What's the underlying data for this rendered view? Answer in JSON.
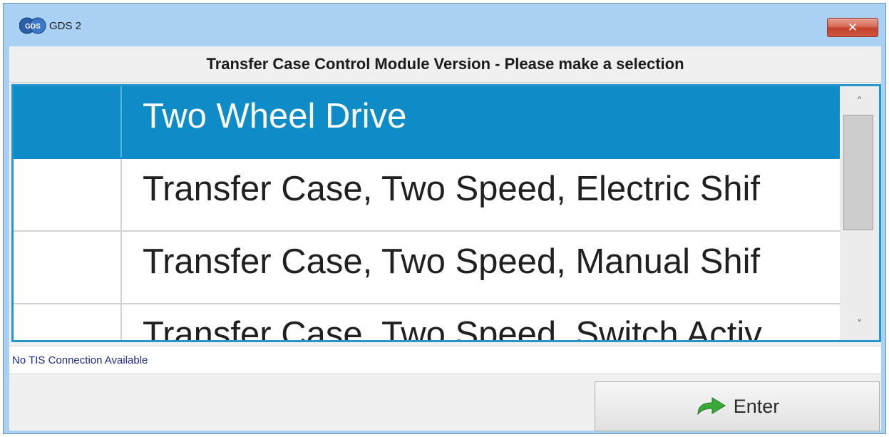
{
  "window": {
    "title": "GDS 2",
    "app_icon_text": "GDS",
    "close_symbol": "✕"
  },
  "header": {
    "title": "Transfer Case Control Module Version - Please make a selection"
  },
  "list": {
    "items": [
      {
        "label": "Two Wheel Drive",
        "selected": true
      },
      {
        "label": "Transfer Case, Two Speed, Electric Shif",
        "selected": false
      },
      {
        "label": "Transfer Case, Two Speed, Manual Shif",
        "selected": false
      },
      {
        "label": "Transfer Case, Two Speed, Switch Activ",
        "selected": false
      }
    ],
    "scroll_up_symbol": "˄",
    "scroll_down_symbol": "˅"
  },
  "status": {
    "text": "No TIS Connection Available"
  },
  "footer": {
    "enter_label": "Enter",
    "enter_icon": "green-arrow-icon"
  },
  "colors": {
    "selection": "#0e8cc8",
    "window_frame": "#a9d1f3",
    "list_border": "#2596c8",
    "status_text": "#1d2b88",
    "arrow_green": "#3aa93a"
  }
}
